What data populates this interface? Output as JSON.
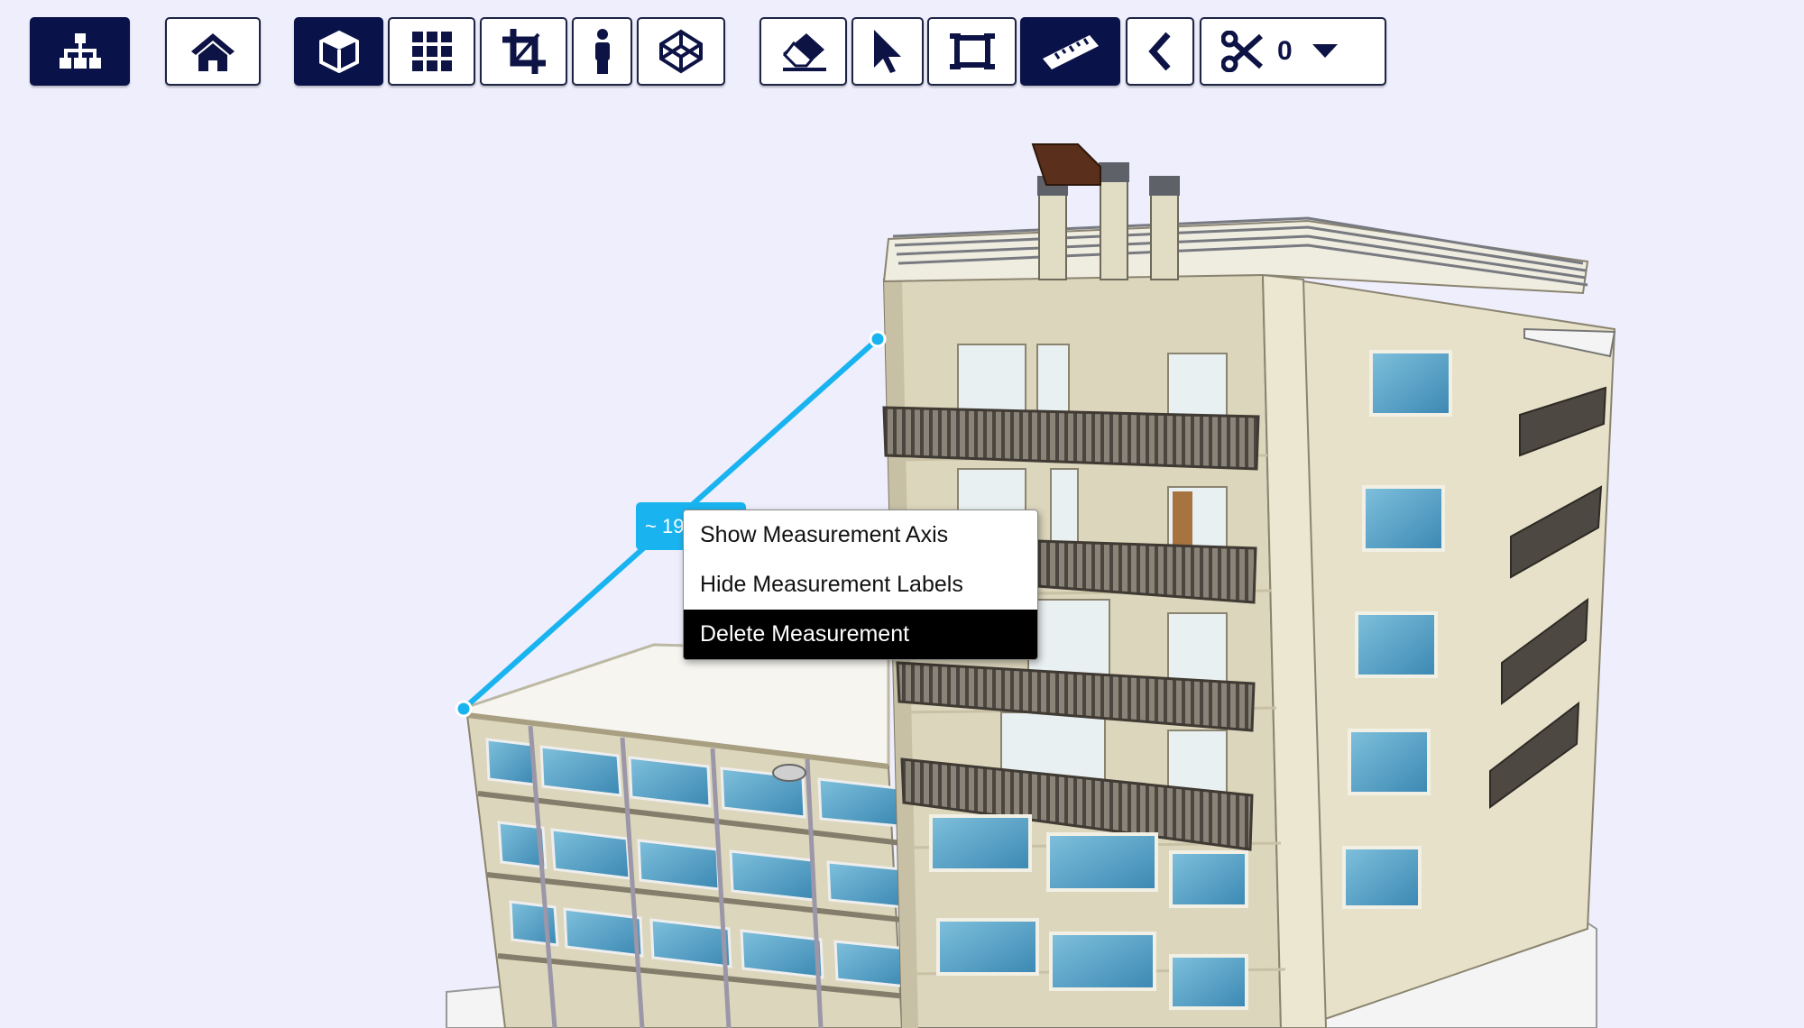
{
  "toolbar": {
    "buttons": [
      {
        "id": "tree",
        "icon": "sitemap-icon",
        "active": true
      },
      {
        "id": "home",
        "icon": "home-icon",
        "active": false
      },
      {
        "id": "perspective",
        "icon": "cube-icon",
        "active": true
      },
      {
        "id": "ortho",
        "icon": "grid-icon",
        "active": false
      },
      {
        "id": "section",
        "icon": "crop-icon",
        "active": false
      },
      {
        "id": "properties",
        "icon": "person-icon",
        "active": false
      },
      {
        "id": "xray",
        "icon": "codepen-icon",
        "active": false
      },
      {
        "id": "hide",
        "icon": "eraser-icon",
        "active": false
      },
      {
        "id": "select",
        "icon": "cursor-icon",
        "active": false
      },
      {
        "id": "fit",
        "icon": "frame-icon",
        "active": false
      },
      {
        "id": "measure",
        "icon": "ruler-icon",
        "active": true
      },
      {
        "id": "back",
        "icon": "chevron-left-icon",
        "active": false
      },
      {
        "id": "slice",
        "icon": "scissors-icon",
        "active": false
      }
    ],
    "section_count": "0",
    "dropdown_icon": "caret-down-icon"
  },
  "measurement": {
    "label": "~ 19",
    "color": "#19b4f0"
  },
  "context_menu": {
    "items": [
      {
        "label": "Show Measurement Axis",
        "highlight": false
      },
      {
        "label": "Hide Measurement Labels",
        "highlight": false
      },
      {
        "label": "Delete Measurement",
        "highlight": true
      }
    ]
  },
  "colors": {
    "background": "#eeeefc",
    "toolbar_active": "#0a1349",
    "facade": "#dcd6bc",
    "glass": "#5fa7c8"
  }
}
